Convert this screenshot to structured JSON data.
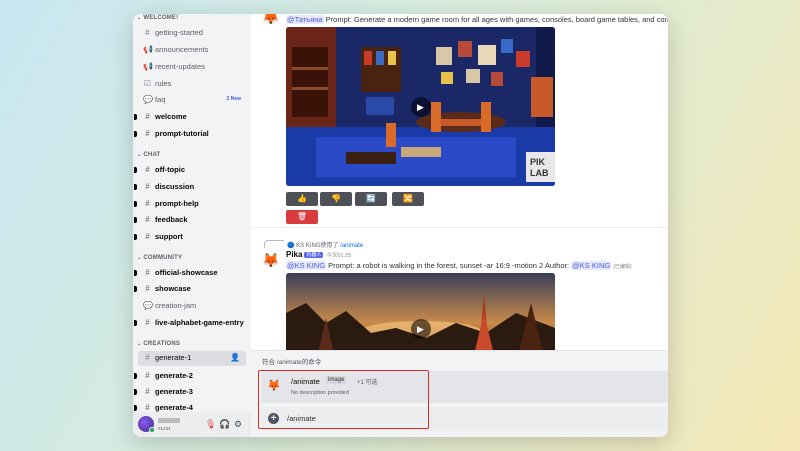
{
  "sidebar": {
    "categories": {
      "welcome": "WELCOME!",
      "chat": "CHAT",
      "community": "COMMUNITY",
      "creations": "CREATIONS"
    },
    "channels": {
      "getting_started": "getting-started",
      "announcements": "announcements",
      "recent_updates": "recent-updates",
      "rules": "rules",
      "faq": "faq",
      "faq_badge": "2 New",
      "welcome": "welcome",
      "prompt_tutorial": "prompt-tutorial",
      "off_topic": "off-topic",
      "discussion": "discussion",
      "prompt_help": "prompt-help",
      "feedback": "feedback",
      "support": "support",
      "official_showcase": "official-showcase",
      "showcase": "showcase",
      "creation_jam": "creation-jam",
      "live_alphabet": "live-alphabet-game-entry",
      "generate_1": "generate-1",
      "generate_2": "generate-2",
      "generate_3": "generate-3",
      "generate_4": "generate-4"
    },
    "user": {
      "tag": "#1234"
    }
  },
  "chat": {
    "msg1": {
      "mention": "@Татьяна",
      "prompt": " Prompt: Generate a modern game room for all ages with games, consoles, board game tables, and comfo"
    },
    "actions": {
      "thumbs_up": "👍",
      "thumbs_down": "👎",
      "refresh": "🔄",
      "shuffle": "🔀",
      "delete": "🗑"
    },
    "msg2": {
      "reply_user": "KS KING",
      "reply_verb": "使用了",
      "reply_cmd": "/animate",
      "author": "Pika",
      "bot_tag": "机器人",
      "time": "今天01:25",
      "mention": "@KS KING",
      "prompt": " Prompt: a robot is walking in the forest, sunset -ar 16:9 -motion 2  Author: ",
      "author_mention": "@KS KING",
      "edited": "(已编辑)"
    }
  },
  "command_popup": {
    "header": "符合 /animate的命令",
    "command": "/animate",
    "param": "image",
    "more": "+1 可选",
    "description": "No description provided",
    "input_value": "/animate"
  },
  "colors": {
    "highlight": "#e02b2b",
    "accent": "#5865f2"
  }
}
